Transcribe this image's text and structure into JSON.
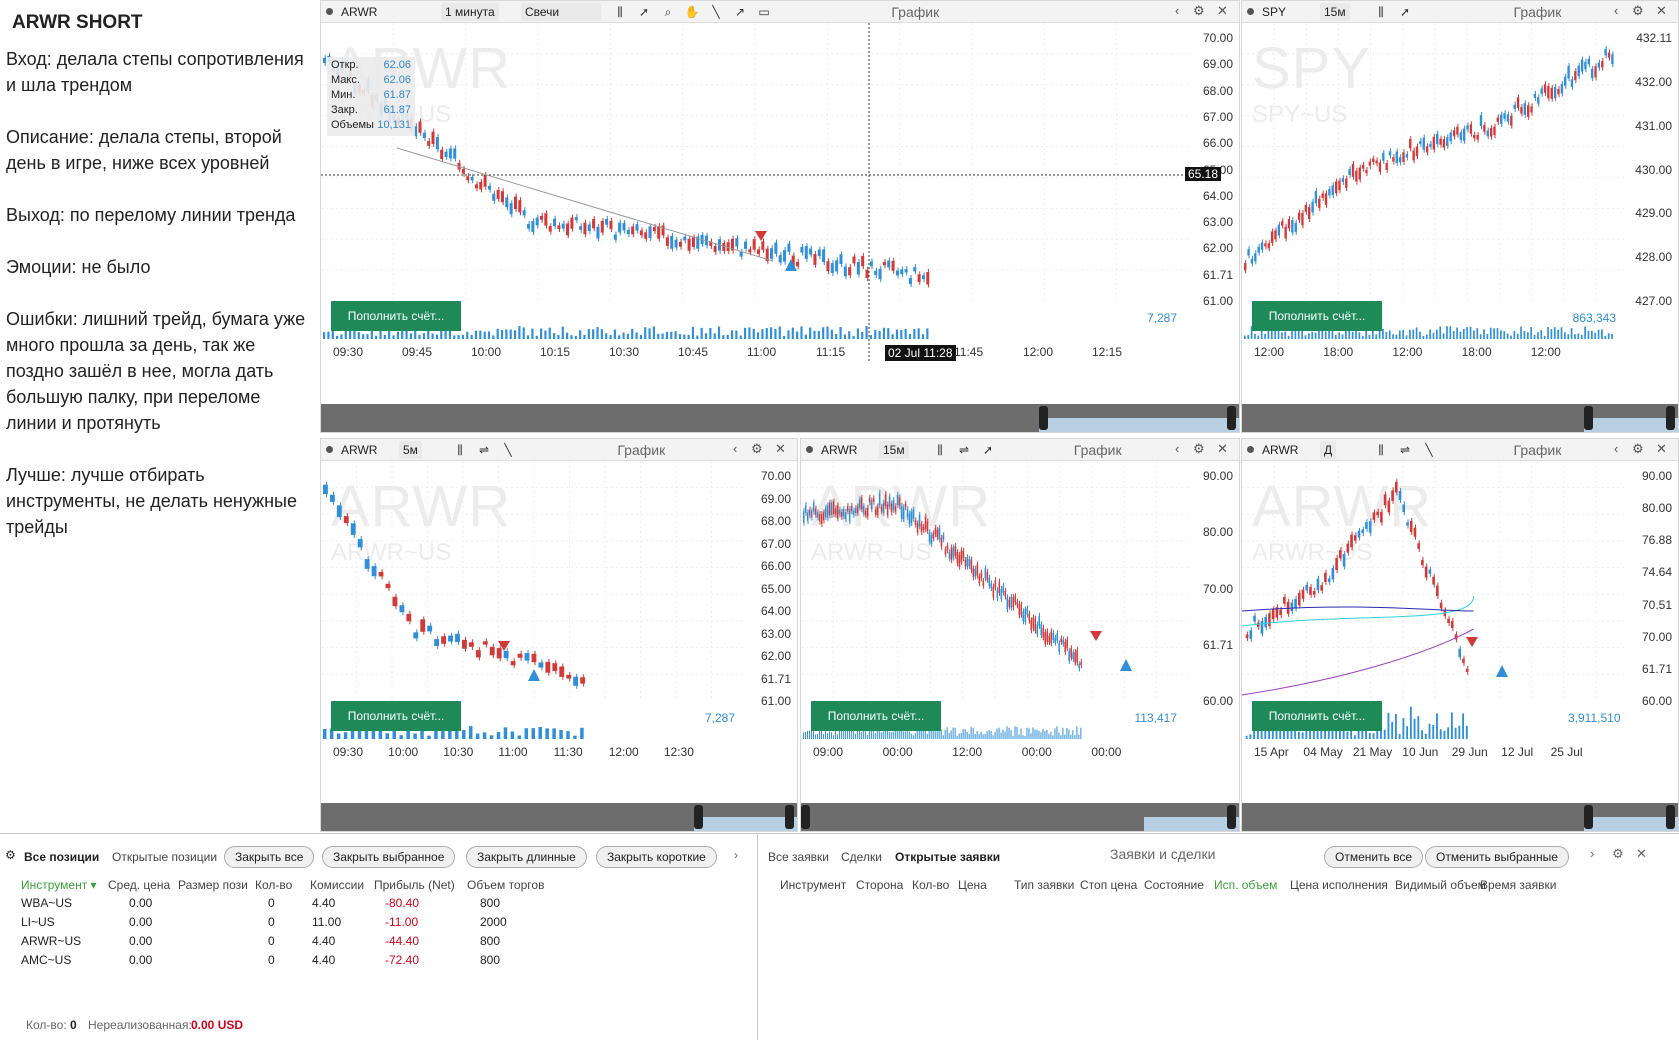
{
  "notes": {
    "title": "ARWR SHORT",
    "paras": [
      "Вход: делала степы сопротивления и шла трендом",
      "Описание: делала степы, второй день в игре, ниже всех уровней",
      "Выход: по перелому линии тренда",
      "Эмоции: не было",
      "Ошибки: лишний трейд, бумага уже много прошла за день, так же поздно зашёл в нее, могла дать большую палку, при переломе линии и протянуть",
      "Лучше: лучше отбирать инструменты, не делать ненужные трейды"
    ]
  },
  "common": {
    "chart_title": "График",
    "fund_btn": "Пополнить счёт..."
  },
  "panels": [
    {
      "sym": "ARWR",
      "tf": "1 минута",
      "type": "Свечи",
      "wm1": "ARWR",
      "wm2": "ARWR~US",
      "ylabels": [
        "70.00",
        "69.00",
        "68.00",
        "67.00",
        "66.00",
        "65.00",
        "64.00",
        "63.00",
        "62.00",
        "61.71",
        "61.00"
      ],
      "xlabels": [
        "09:30",
        "09:45",
        "10:00",
        "10:15",
        "10:30",
        "10:45",
        "11:00",
        "11:15",
        "02 Jul 11:28",
        "11:45",
        "12:00",
        "12:15"
      ],
      "crosshair_price": "65.18",
      "volume": "7,287",
      "ohlc": [
        {
          "k": "Откр.",
          "v": "62.06"
        },
        {
          "k": "Макс.",
          "v": "62.06"
        },
        {
          "k": "Мин.",
          "v": "61.87"
        },
        {
          "k": "Закр.",
          "v": "61.87"
        },
        {
          "k": "Объемы",
          "v": "10,131"
        }
      ]
    },
    {
      "sym": "SPY",
      "tf": "15м",
      "wm1": "SPY",
      "wm2": "SPY~US",
      "ylabels": [
        "432.11",
        "432.00",
        "431.00",
        "430.00",
        "429.00",
        "428.00",
        "427.00"
      ],
      "xlabels": [
        "12:00",
        "18:00",
        "12:00",
        "18:00",
        "12:00"
      ],
      "volume": "863,343"
    },
    {
      "sym": "ARWR",
      "tf": "5м",
      "wm1": "ARWR",
      "wm2": "ARWR~US",
      "ylabels": [
        "70.00",
        "69.00",
        "68.00",
        "67.00",
        "66.00",
        "65.00",
        "64.00",
        "63.00",
        "62.00",
        "61.71",
        "61.00"
      ],
      "xlabels": [
        "09:30",
        "10:00",
        "10:30",
        "11:00",
        "11:30",
        "12:00",
        "12:30"
      ],
      "volume": "7,287"
    },
    {
      "sym": "ARWR",
      "tf": "15м",
      "wm1": "ARWR",
      "wm2": "ARWR~US",
      "ylabels": [
        "90.00",
        "80.00",
        "70.00",
        "61.71",
        "60.00"
      ],
      "xlabels": [
        "09:00",
        "00:00",
        "12:00",
        "00:00",
        "00:00"
      ],
      "volume": "113,417"
    },
    {
      "sym": "ARWR",
      "tf": "Д",
      "wm1": "ARWR",
      "wm2": "ARWR~US",
      "ylabels": [
        "90.00",
        "80.00",
        "76.88",
        "74.64",
        "70.51",
        "70.00",
        "61.71",
        "60.00"
      ],
      "xlabels": [
        "15 Apr",
        "04 May",
        "21 May",
        "10 Jun",
        "29 Jun",
        "12 Jul",
        "25 Jul"
      ],
      "volume": "3,911,510"
    }
  ],
  "positions": {
    "tabs": [
      "Все позиции",
      "Открытые позиции"
    ],
    "buttons": [
      "Закрыть все",
      "Закрыть выбранное",
      "Закрыть длинные",
      "Закрыть короткие"
    ],
    "headers": [
      "Инструмент",
      "Сред. цена",
      "Размер пози",
      "Кол-во",
      "Комиссии",
      "Прибыль (Net)",
      "Объем торгов"
    ],
    "rows": [
      [
        "WBA~US",
        "0.00",
        "0",
        "4.40",
        "-80.40",
        "800"
      ],
      [
        "LI~US",
        "0.00",
        "0",
        "11.00",
        "-11.00",
        "2000"
      ],
      [
        "ARWR~US",
        "0.00",
        "0",
        "4.40",
        "-44.40",
        "800"
      ],
      [
        "AMC~US",
        "0.00",
        "0",
        "4.40",
        "-72.40",
        "800"
      ]
    ],
    "footer_qty_label": "Кол-во:",
    "footer_qty": "0",
    "footer_unreal_label": "Нереализованная:",
    "footer_unreal": "0.00 USD"
  },
  "orders": {
    "tabs": [
      "Все заявки",
      "Сделки",
      "Открытые заявки"
    ],
    "title": "Заявки и сделки",
    "buttons": [
      "Отменить все",
      "Отменить выбранные"
    ],
    "headers": [
      "Инструмент",
      "Сторона",
      "Кол-во",
      "Цена",
      "Тип заявки",
      "Стоп цена",
      "Состояние",
      "Исп. объем",
      "Цена исполнения",
      "Видимый объем",
      "Время заявки"
    ]
  },
  "colors": {
    "up": "#2f8fd8",
    "down": "#d23a3a",
    "fund": "#1e8a58",
    "pos_loss": "#d0021b",
    "sort": "#3aa03a"
  }
}
